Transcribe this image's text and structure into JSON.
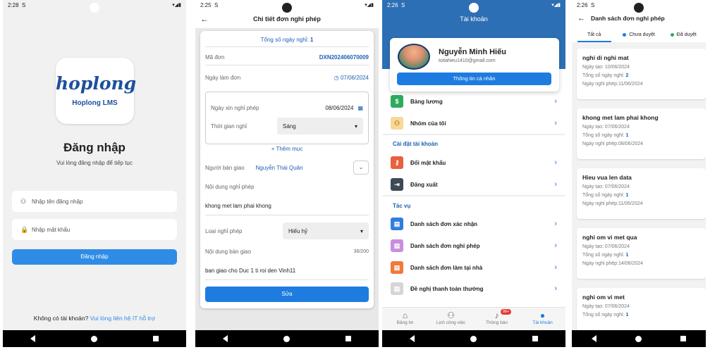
{
  "login": {
    "status_time": "2:28",
    "status_s": "S",
    "status_right": "▾◢▮",
    "logo_word": "hoplong",
    "logo_sub": "Hoplong LMS",
    "title": "Đăng nhập",
    "subtitle": "Vui lòng đăng nhập để tiếp tục",
    "username_placeholder": "Nhập tên đăng nhập",
    "password_placeholder": "Nhập mật khẩu",
    "login_button": "Đăng nhập",
    "footer_text": "Không có tài khoản? ",
    "footer_link": "Vui lòng liên hệ IT hỗ trợ"
  },
  "detail": {
    "status_time": "2:25",
    "status_s": "S",
    "status_right": "▾◢▮",
    "title": "Chi tiết đơn nghỉ phép",
    "total_label": "Tổng số ngày nghỉ:",
    "total_value": "1",
    "code_label": "Mã đơn",
    "code_value": "DXN202406070009",
    "date_label": "Ngày làm đơn",
    "date_value": "07/06/2024",
    "leave_date_label": "Ngày xin nghỉ phép",
    "leave_date_value": "08/06/2024",
    "time_label": "Thời gian nghỉ",
    "time_value": "Sáng",
    "add_more": "+ Thêm mục",
    "handover_label": "Người bàn giao",
    "handover_value": "Nguyễn Thái Quân",
    "content_label": "Nội dung nghỉ phép",
    "content_value": "khong met lam phai khong",
    "type_label": "Loại nghỉ phép",
    "type_value": "Hiếu hỷ",
    "handover_content_label": "Nội dung bàn giao",
    "handover_counter": "36/200",
    "handover_content_value": "ban giao cho Duc 1 ti roi den Vinh11",
    "save_button": "Sửa"
  },
  "account": {
    "status_time": "2:26",
    "status_s": "S",
    "status_right": "▾◢▮",
    "title": "Tài khoản",
    "name": "Nguyễn Minh Hiếu",
    "email": "toilahieu1410@gmail.com",
    "profile_button": "Thông tin cá nhân",
    "items_top": [
      {
        "label": "Bảng lương",
        "icon": "$",
        "color": "#2eaa5c"
      },
      {
        "label": "Nhóm của tôi",
        "icon": "👥",
        "color": "#f2b24b"
      }
    ],
    "section_settings": "Cài đặt tài khoản",
    "items_settings": [
      {
        "label": "Đổi mật khẩu",
        "icon": "🔑",
        "color": "#e8603c"
      },
      {
        "label": "Đăng xuất",
        "icon": "⇥",
        "color": "#3d4a57"
      }
    ],
    "section_tasks": "Tác vụ",
    "items_tasks": [
      {
        "label": "Danh sách đơn xác nhận",
        "icon": "▤",
        "color": "#2f7fdb"
      },
      {
        "label": "Danh sách đơn nghỉ phép",
        "icon": "▤",
        "color": "#c88de0"
      },
      {
        "label": "Danh sách đơn làm tại nhà",
        "icon": "▤",
        "color": "#f07a3a"
      },
      {
        "label": "Đề nghị thanh toán thường",
        "icon": "▤",
        "color": "#c9c9c9"
      }
    ],
    "bottom_nav": [
      {
        "label": "Bảng tin",
        "icon": "⌂"
      },
      {
        "label": "Lịch công việc",
        "icon": "⚇"
      },
      {
        "label": "Thông báo",
        "icon": "🔔",
        "badge": "99+"
      },
      {
        "label": "Tài khoản",
        "icon": "👤"
      }
    ]
  },
  "list": {
    "status_time": "2:26",
    "status_s": "S",
    "status_right": "▾◢▮",
    "title": "Danh sách đơn nghỉ phép",
    "tabs": [
      {
        "label": "Tất cả",
        "dot": ""
      },
      {
        "label": "Chưa duyệt",
        "dot": "#1e7ce0"
      },
      {
        "label": "Đã duyệt",
        "dot": "#2eaa5c"
      }
    ],
    "created_label": "Ngày tạo: ",
    "days_label": "Tổng số ngày nghỉ: ",
    "leave_label": "Ngày nghỉ phép:",
    "items": [
      {
        "title": "nghi di nghi mat",
        "created": "10/06/2024",
        "days": "2",
        "leave": "11/06/2024"
      },
      {
        "title": "khong met lam phai khong",
        "created": "07/06/2024",
        "days": "1",
        "leave": "08/06/2024"
      },
      {
        "title": "Hieu vua len data",
        "created": "07/06/2024",
        "days": "1",
        "leave": "11/06/2024"
      },
      {
        "title": "nghi om vi met qua",
        "created": "07/06/2024",
        "days": "1",
        "leave": "14/06/2024"
      },
      {
        "title": "nghi om vi met",
        "created": "07/06/2024",
        "days": "1",
        "leave": ""
      }
    ]
  }
}
